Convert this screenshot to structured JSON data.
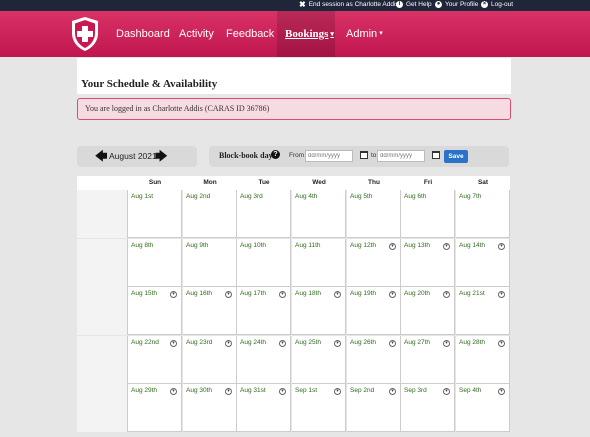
{
  "topbar": {
    "end_session": "End session as Charlotte Addis",
    "get_help": "Get Help",
    "your_profile": "Your Profile",
    "logout": "Log-out"
  },
  "nav": {
    "items": [
      "Dashboard",
      "Activity",
      "Feedback",
      "Bookings",
      "Admin"
    ],
    "active": "Bookings",
    "brand_color": "#c8184f"
  },
  "page": {
    "title": "Your Schedule & Availability",
    "alert": "You are logged in as Charlotte Addis (CARAS ID 36786)"
  },
  "calendar_nav": {
    "month": "August 2021"
  },
  "block_book": {
    "title": "Block-book days",
    "from_label": "From",
    "to_label": "to",
    "from_placeholder": "dd/mm/yyyy",
    "to_placeholder": "dd/mm/yyyy",
    "save_label": "Save"
  },
  "calendar": {
    "day_names": [
      "Sun",
      "Mon",
      "Tue",
      "Wed",
      "Thu",
      "Fri",
      "Sat"
    ],
    "weeks": [
      [
        {
          "label": "Aug 1st",
          "chev": false
        },
        {
          "label": "Aug 2nd",
          "chev": false
        },
        {
          "label": "Aug 3rd",
          "chev": false
        },
        {
          "label": "Aug 4th",
          "chev": false
        },
        {
          "label": "Aug 5th",
          "chev": false
        },
        {
          "label": "Aug 6th",
          "chev": false
        },
        {
          "label": "Aug 7th",
          "chev": false
        }
      ],
      [
        {
          "label": "Aug 8th",
          "chev": false
        },
        {
          "label": "Aug 9th",
          "chev": false
        },
        {
          "label": "Aug 10th",
          "chev": false
        },
        {
          "label": "Aug 11th",
          "chev": false
        },
        {
          "label": "Aug 12th",
          "chev": true
        },
        {
          "label": "Aug 13th",
          "chev": true
        },
        {
          "label": "Aug 14th",
          "chev": true
        }
      ],
      [
        {
          "label": "Aug 15th",
          "chev": true
        },
        {
          "label": "Aug 16th",
          "chev": true
        },
        {
          "label": "Aug 17th",
          "chev": true
        },
        {
          "label": "Aug 18th",
          "chev": true
        },
        {
          "label": "Aug 19th",
          "chev": true
        },
        {
          "label": "Aug 20th",
          "chev": true
        },
        {
          "label": "Aug 21st",
          "chev": true
        }
      ],
      [
        {
          "label": "Aug 22nd",
          "chev": true
        },
        {
          "label": "Aug 23rd",
          "chev": true
        },
        {
          "label": "Aug 24th",
          "chev": true
        },
        {
          "label": "Aug 25th",
          "chev": true
        },
        {
          "label": "Aug 26th",
          "chev": true
        },
        {
          "label": "Aug 27th",
          "chev": true
        },
        {
          "label": "Aug 28th",
          "chev": true
        }
      ],
      [
        {
          "label": "Aug 29th",
          "chev": true
        },
        {
          "label": "Aug 30th",
          "chev": true
        },
        {
          "label": "Aug 31st",
          "chev": true
        },
        {
          "label": "Sep 1st",
          "chev": true
        },
        {
          "label": "Sep 2nd",
          "chev": true
        },
        {
          "label": "Sep 3rd",
          "chev": true
        },
        {
          "label": "Sep 4th",
          "chev": true
        }
      ]
    ]
  }
}
